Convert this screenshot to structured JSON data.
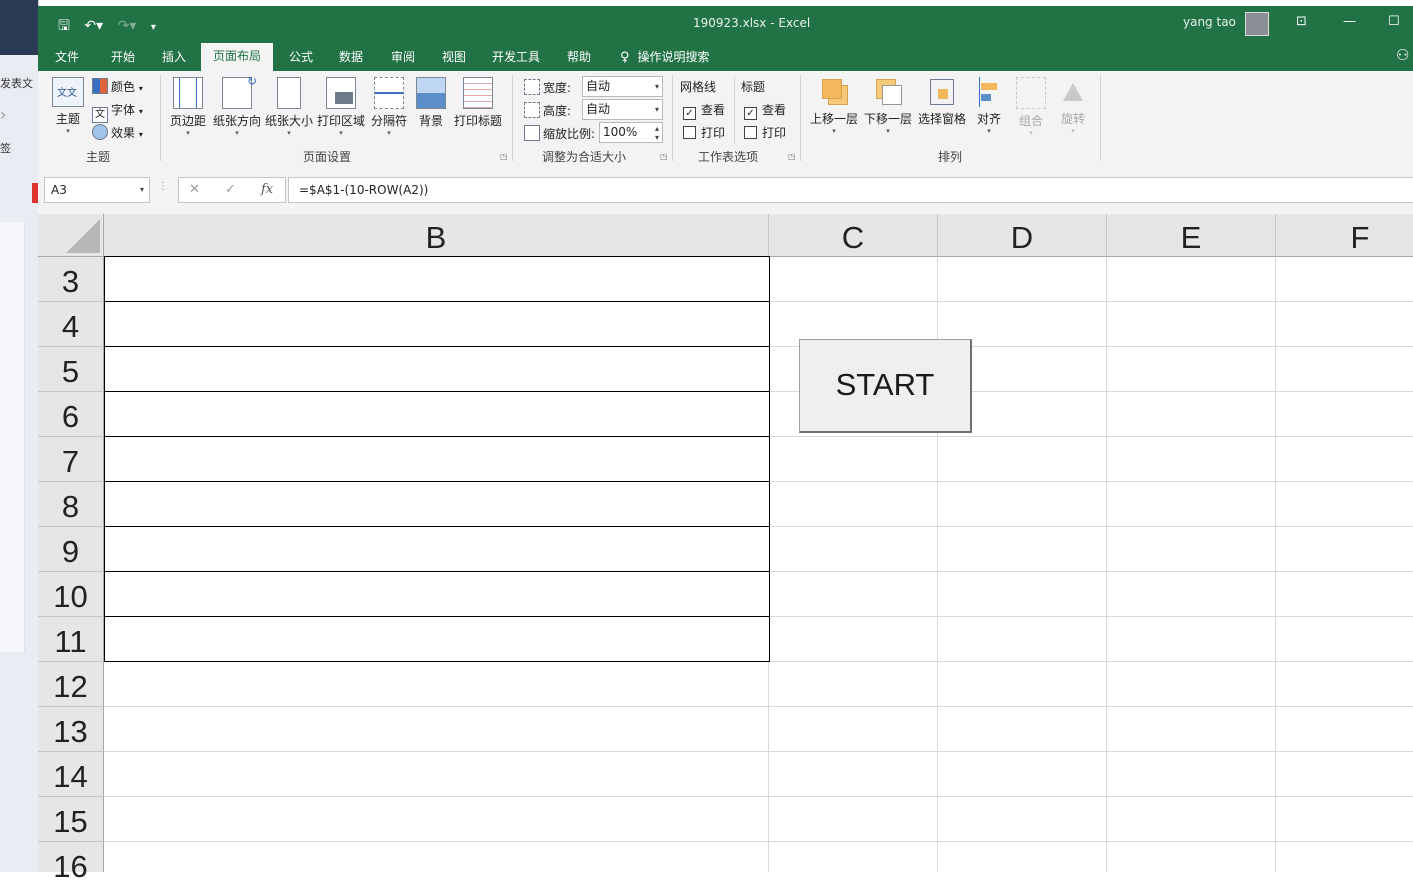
{
  "background_window": {
    "line1": "发表文",
    "line2": "签"
  },
  "titlebar": {
    "title": "190923.xlsx  -  Excel",
    "user": "yang tao"
  },
  "tabs": [
    "文件",
    "开始",
    "插入",
    "页面布局",
    "公式",
    "数据",
    "审阅",
    "视图",
    "开发工具",
    "帮助"
  ],
  "active_tab": "页面布局",
  "tell_me": "操作说明搜索",
  "ribbon": {
    "theme_group": {
      "label": "主题",
      "theme_btn": "主题",
      "colors": "颜色",
      "fonts": "字体",
      "effects": "效果"
    },
    "page_setup": {
      "label": "页面设置",
      "margins": "页边距",
      "orientation": "纸张方向",
      "size": "纸张大小",
      "print_area": "打印区域",
      "breaks": "分隔符",
      "background": "背景",
      "print_titles": "打印标题"
    },
    "scale_to_fit": {
      "label": "调整为合适大小",
      "width_label": "宽度:",
      "width_value": "自动",
      "height_label": "高度:",
      "height_value": "自动",
      "scale_label": "缩放比例:",
      "scale_value": "100%"
    },
    "sheet_options": {
      "label": "工作表选项",
      "gridlines": "网格线",
      "headings": "标题",
      "view": "查看",
      "print": "打印",
      "gridlines_view": true,
      "gridlines_print": false,
      "headings_view": true,
      "headings_print": false
    },
    "arrange": {
      "label": "排列",
      "bring_forward": "上移一层",
      "send_backward": "下移一层",
      "selection_pane": "选择窗格",
      "align": "对齐",
      "group": "组合",
      "rotate": "旋转"
    }
  },
  "formula_bar": {
    "name_box": "A3",
    "fx": "fx",
    "formula": "=$A$1-(10-ROW(A2))"
  },
  "columns": [
    "B",
    "C",
    "D",
    "E",
    "F"
  ],
  "rows": [
    "3",
    "4",
    "5",
    "6",
    "7",
    "8",
    "9",
    "10",
    "11",
    "12",
    "13",
    "14",
    "15",
    "16"
  ],
  "start_button": "START"
}
